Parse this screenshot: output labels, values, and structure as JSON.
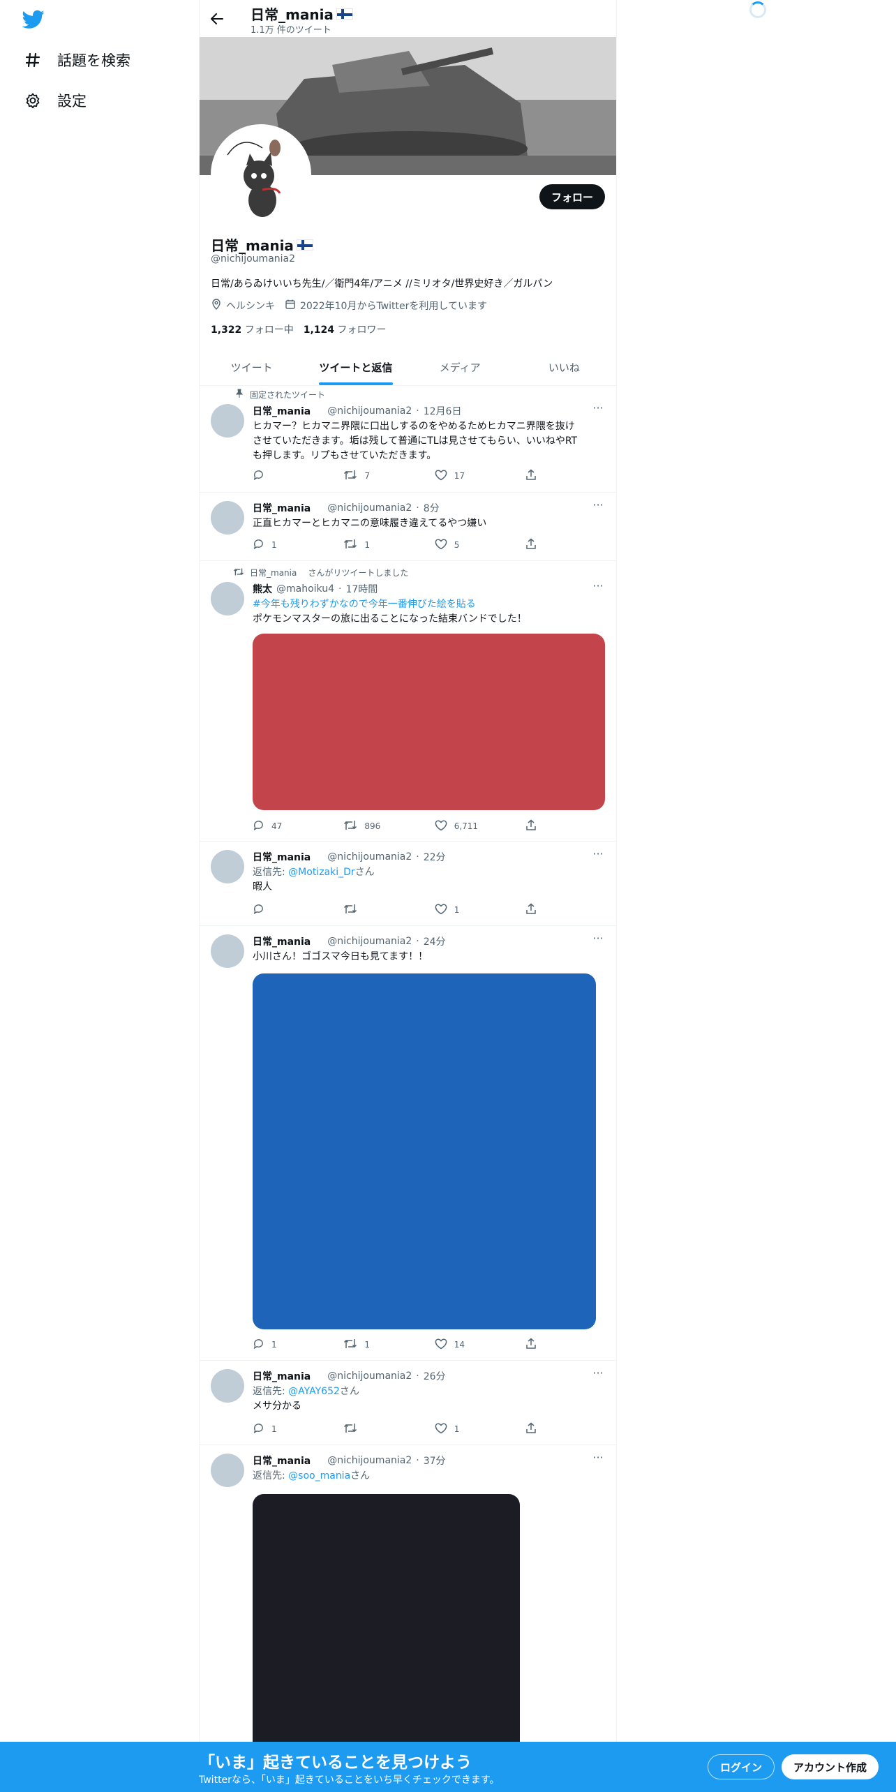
{
  "sidebar": {
    "items": [
      {
        "label": "話題を検索",
        "icon": "hashtag-icon"
      },
      {
        "label": "設定",
        "icon": "gear-icon"
      }
    ]
  },
  "header": {
    "name": "日常_mania",
    "tweet_count": "1.1万 件のツイート"
  },
  "profile": {
    "follow_label": "フォロー",
    "name": "日常_mania",
    "handle": "@nichijoumania2",
    "bio": "日常/あらゐけいいち先生/／衛門4年/アニメ //ミリオタ/世界史好き／ガルパン",
    "location": "ヘルシンキ",
    "joined": "2022年10月からTwitterを利用しています",
    "following_count": "1,322",
    "following_label": "フォロー中",
    "followers_count": "1,124",
    "followers_label": "フォロワー"
  },
  "tabs": [
    {
      "label": "ツイート",
      "active": false
    },
    {
      "label": "ツイートと返信",
      "active": true
    },
    {
      "label": "メディア",
      "active": false
    },
    {
      "label": "いいね",
      "active": false
    }
  ],
  "tweets": [
    {
      "context": "固定されたツイート",
      "name": "日常_mania",
      "handle": "@nichijoumania2",
      "time": "12月6日",
      "text_lines": [
        "ヒカマー？ヒカマニ界隈に口出しするのをやめるためヒカマニ界隈を抜け",
        "させていただきます。垢は残して普通にTLは見させてもらい、いいねやRT",
        "も押します。リプもさせていただきます。"
      ],
      "replies": "",
      "retweets": "7",
      "likes": "17"
    },
    {
      "name": "日常_mania",
      "handle": "@nichijoumania2",
      "time": "8分",
      "text": "正直ヒカマーとヒカマニの意味履き違えてるやつ嫌い",
      "replies": "1",
      "retweets": "1",
      "likes": "5"
    },
    {
      "context_name": "日常_mania",
      "context": "さんがリツイートしました",
      "name": "熊太",
      "handle": "@mahoiku4",
      "time": "17時間",
      "hashtag": "#今年も残りわずかなので今年一番伸びた絵を貼る",
      "text": "ポケモンマスターの旅に出ることになった結束バンドでした！",
      "media_color": "#c4444c",
      "replies": "47",
      "retweets": "896",
      "likes": "6,711"
    },
    {
      "name": "日常_mania",
      "handle": "@nichijoumania2",
      "time": "22分",
      "reply_prefix": "返信先: ",
      "reply_to": "@Motizaki_Dr",
      "reply_suffix": "さん",
      "text": "暇人",
      "replies": "",
      "retweets": "",
      "likes": "1"
    },
    {
      "name": "日常_mania",
      "handle": "@nichijoumania2",
      "time": "24分",
      "text": "小川さん！ゴゴスマ今日も見てます！！",
      "media_color": "#1e64b8",
      "replies": "1",
      "retweets": "1",
      "likes": "14"
    },
    {
      "name": "日常_mania",
      "handle": "@nichijoumania2",
      "time": "26分",
      "reply_prefix": "返信先: ",
      "reply_to": "@AYAY652",
      "reply_suffix": "さん",
      "text": "メサ分かる",
      "replies": "1",
      "retweets": "",
      "likes": "1"
    },
    {
      "name": "日常_mania",
      "handle": "@nichijoumania2",
      "time": "37分",
      "reply_prefix": "返信先: ",
      "reply_to": "@soo_mania",
      "reply_suffix": "さん",
      "media_color": "#1c1d24"
    }
  ],
  "bottom_bar": {
    "title": "「いま」起きていることを見つけよう",
    "subtitle": "Twitterなら、「いま」起きていることをいち早くチェックできます。",
    "login": "ログイン",
    "signup": "アカウント作成"
  },
  "colors": {
    "accent": "#1d9bf0",
    "text": "#0f1419",
    "secondary": "#536471"
  }
}
